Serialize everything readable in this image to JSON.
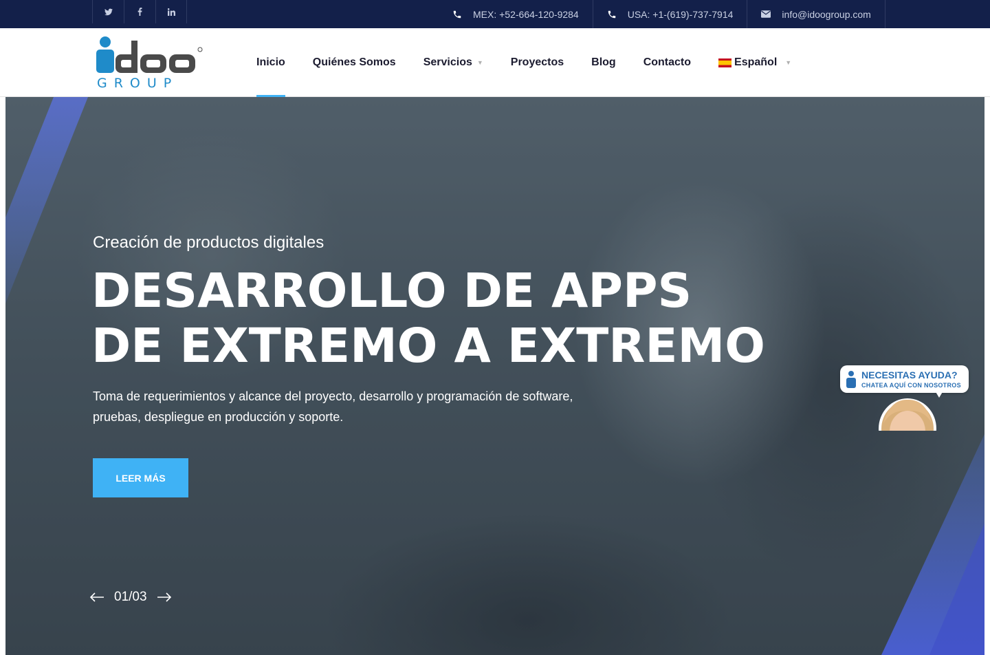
{
  "topbar": {
    "social": [
      {
        "icon": "twitter-icon",
        "label": "𝕥"
      },
      {
        "icon": "facebook-icon",
        "label": "f"
      },
      {
        "icon": "linkedin-icon",
        "label": "in"
      }
    ],
    "contacts": [
      {
        "icon": "phone-icon",
        "text": "MEX: +52-664-120-9284"
      },
      {
        "icon": "phone-icon",
        "text": "USA: +1-(619)-737-7914"
      },
      {
        "icon": "envelope-icon",
        "text": "info@idoogroup.com"
      }
    ]
  },
  "logo": {
    "main": "idoo",
    "sub": "GROUP"
  },
  "nav": {
    "items": [
      {
        "label": "Inicio",
        "active": true
      },
      {
        "label": "Quiénes Somos"
      },
      {
        "label": "Servicios",
        "dropdown": true
      },
      {
        "label": "Proyectos"
      },
      {
        "label": "Blog"
      },
      {
        "label": "Contacto"
      }
    ],
    "language": {
      "label": "Español",
      "flag": "spain-flag-icon"
    }
  },
  "hero": {
    "subtitle": "Creación de productos digitales",
    "title_line1": "DESARROLLO DE APPS",
    "title_line2": "DE EXTREMO A EXTREMO",
    "description": "Toma de requerimientos y alcance del proyecto, desarrollo y programación de software, pruebas, despliegue en producción y soporte.",
    "button": "LEER MÁS",
    "slide_counter": "01/03"
  },
  "chat": {
    "line1": "NECESITAS AYUDA?",
    "line2": "CHATEA AQUÍ CON NOSOTROS"
  },
  "colors": {
    "topbar_bg": "#13204a",
    "accent": "#3fb2f5",
    "logo_blue": "#1f8bc9",
    "logo_dark": "#4a4a4a",
    "stripe_blue": "#4f72d8"
  }
}
